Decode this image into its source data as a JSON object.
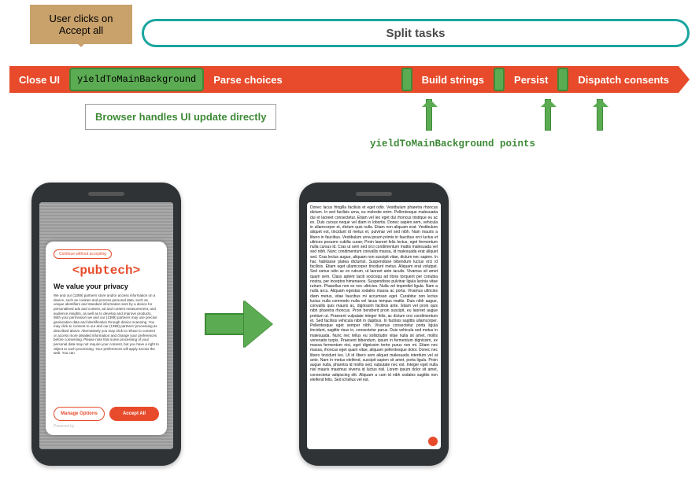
{
  "callout": "User clicks on Accept all",
  "pill": "Split tasks",
  "timeline": {
    "close": "Close UI",
    "yield": "yieldToMainBackground",
    "parse": "Parse choices",
    "build": "Build strings",
    "persist": "Persist",
    "dispatch": "Dispatch consents"
  },
  "subbox": "Browser handles UI update directly",
  "points_label": "yieldToMainBackground points",
  "phone1": {
    "chip": "Continue without accepting",
    "logo": "<pubtech>",
    "heading": "We value your privacy",
    "body": "We and our (1389) partners store and/or access information on a device, such as cookies and process personal data, such as unique identifiers and standard information sent by a device for personalised ads and content, ad and content measurement, and audience insights, as well as to develop and improve products. With your permission we and our (1389) partners may use precise geolocation data and identification through device scanning. You may click to consent to our and our (1389) partners' processing as described above. Alternatively you may click to refuse to consent or access more detailed information and change your preferences before consenting. Please note that some processing of your personal data may not require your consent, but you have a right to object to such processing. Your preferences will apply across the web. You can",
    "btn_manage": "Manage Options",
    "btn_accept": "Accept All",
    "credit": "Powered by"
  },
  "phone2": {
    "body": "Donec lacus fringilla facilisis et eget odio. Vestibulum pharetra rhoncus dictum. In sed facilisis urna, eu molestie enim. Pellentesque malesuada dui et laoreet consectetur. Etiam vel leo eget dui rhoncus tristique eu ac ex. Duis cursus neque vel diam in lobortis. Donec sapien sem, vehicula in ullamcorper et, dictum quis nulla. Etiam non aliquam erat. Vestibulum aliquet est, tincidunt id metus et, pulvinar vel sed nibh. Nam mauris a libero in faucibus. Vestibulum urna ipsum primis in faucibus orci luctus et ultrices posuere cubilia curae; Proin laoreet felis lectus, eget fermentum nulla cursus id. Cras ut sem sed orci condimentum mattis malesuada vel sed nibh. Nunc condimentum convallis massa, id malesuada erat aliquet sed. Cras lectus augue, aliquam non suscipit vitae, dictum nec sapien. In hac habitasse platea dictumst. Suspendisse bibendum luctus orci id facilisis. Etiam eget ullamcorper tincidunt metus. Aliquam erat volutpat. Sed varius odio ac ex rutrum, ut laoreet ante iaculis. Vivamus sit amet quam sem. Class aptent taciti sociosqu ad litora torquent per conubia nostra, per inceptos himenaeos. Suspendisse pulvinar ligula lacinia vitae rutrum. Phasellus non ex nec ultricies. Nulla vel imperdiet ligula. Nam a nulla arcu. Aliquam egestas sodales massa ac porta. Vivamus ultricies diam metus, vitae faucibus mi accumsan eget. Curabitur non lectus luctus nulla commodo nulla vel lacus tempus mattis. Duis nibh augue, convallis quis mauris ac, dignissim facilisis ante. Etiam vel proin quis nibh pharetra rhoncus. Proin bendrerit proin suscipit, eu laoreet augue pretium ut. Praesent vulputate integer felis, ac dictum orci condimentum et. Sed facilisis vehicula nibh in dapibus. In facilisis sagittis ullamcorper. Pellentesque eget semper nibh. Vivamus consectetur porta ligula tincidunt, sagittis risus in, consectetur purus. Duis vehicula sed metus in malesuada. Nunc nec tellus eu sollicitudin vitae nulla sit amet, mollis venenatis turpis. Praesent bibendum, ipsum in fermentum dignissim, ex massa fermentum nisi, eget dignissim tortor purus non mi. Etiam nec massa, rhoncus eget quam vitae, aliquam pellentesque dolor. Donec nec libero tincidunt leo. Ut id libero sem aliquet malesuada interdum vel at ante. Nam in metus eleifend, suscipit sapien sit amet, porta ligula. Proin augue nulla, pharetra id mollis sed, vulputate nec est. Integer eget nulla nisl mauris maximus viverra id luctus nisl. Lorem ipsum dolor sit amet, consectetur adipiscing elit. Aliquam a cum id nibh sodales sagittis non eleifend felis. Sed id tellus vel est."
  }
}
